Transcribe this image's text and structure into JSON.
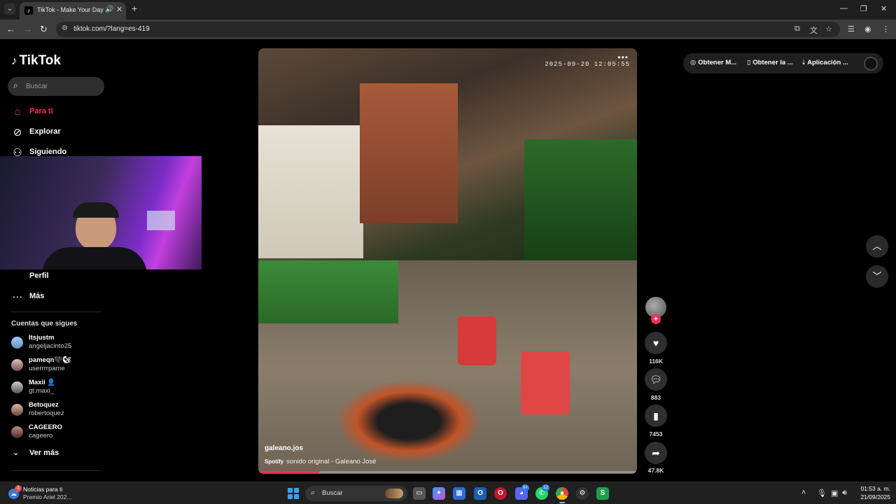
{
  "browser": {
    "tab_title": "TikTok - Make Your Day",
    "url": "tiktok.com/?lang=es-419"
  },
  "sidebar": {
    "logo": "TikTok",
    "search_placeholder": "Buscar",
    "nav": [
      {
        "label": "Para ti"
      },
      {
        "label": "Explorar"
      },
      {
        "label": "Siguiendo"
      },
      {
        "label": "Perfil"
      },
      {
        "label": "Más"
      }
    ],
    "accounts_title": "Cuentas que sigues",
    "accounts": [
      {
        "name": "Itsjustm",
        "handle": "angeljacinto25"
      },
      {
        "name": "pameqn🖤🐿",
        "handle": "userrrrpame"
      },
      {
        "name": "Maxii 👤",
        "handle": "gt.maxi_"
      },
      {
        "name": "Betoquez",
        "handle": "robertoquez"
      },
      {
        "name": "CAGEERO",
        "handle": "cageero"
      }
    ],
    "see_more": "Ver más"
  },
  "video": {
    "timestamp": "2025-09-20 12:05:55",
    "author": "galeano.jos",
    "sound_brand": "Spotify",
    "sound": "sonido original - Galeano José",
    "progress": 0.16
  },
  "actions": {
    "likes": "116K",
    "comments": "883",
    "saves": "7453",
    "shares": "47.8K"
  },
  "top_actions": [
    {
      "label": "Obtener M..."
    },
    {
      "label": "Obtener la ..."
    },
    {
      "label": "Aplicación ..."
    }
  ],
  "taskbar": {
    "news_title": "Noticias para ti",
    "news_sub": "Premio Ariel 202...",
    "news_badge": "3",
    "search": "Buscar",
    "discord_badge": "9+",
    "whatsapp_badge": "12",
    "time": "01:53 a. m.",
    "date": "21/09/2025"
  },
  "colors": {
    "accent": "#fe2c55",
    "background": "#000000"
  }
}
